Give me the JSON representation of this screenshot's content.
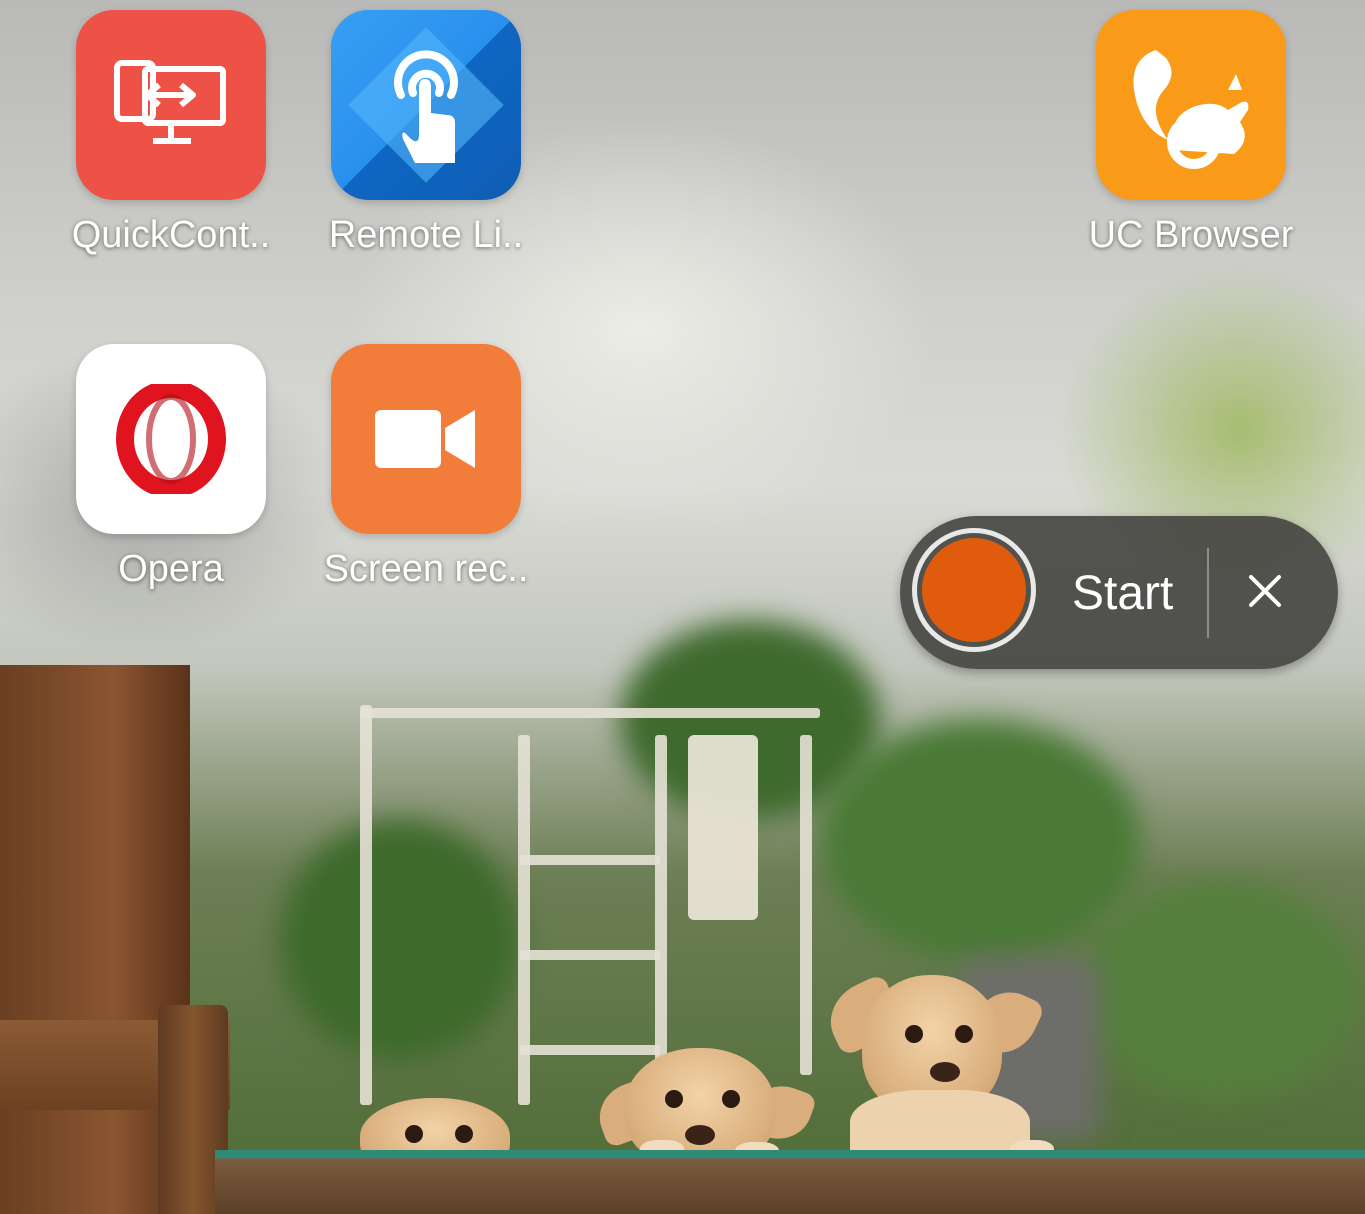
{
  "home_screen": {
    "apps": [
      {
        "label": "QuickCont..",
        "icon": "screen-transfer-icon",
        "color": "#ee5246"
      },
      {
        "label": "Remote Li..",
        "icon": "touch-icon",
        "color": "#1a7fe0"
      },
      {
        "label": "UC Browser",
        "icon": "squirrel-icon",
        "color": "#f99b18"
      },
      {
        "label": "Opera",
        "icon": "opera-o-icon",
        "color": "#ffffff"
      },
      {
        "label": "Screen rec..",
        "icon": "video-camera-icon",
        "color": "#f27c3a"
      }
    ]
  },
  "recorder": {
    "start_label": "Start",
    "close_symbol": "×",
    "record_color": "#e05c0c"
  }
}
